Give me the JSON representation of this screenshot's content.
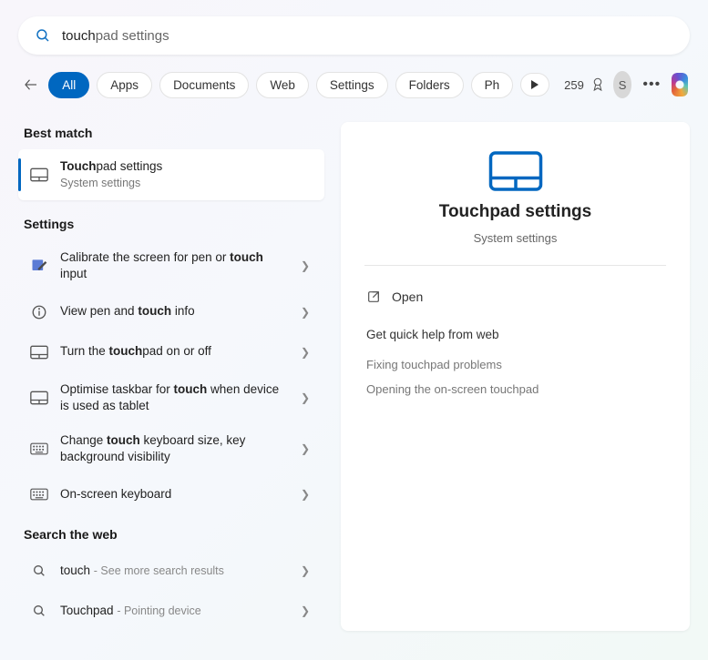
{
  "search": {
    "typed": "touch",
    "completion": "pad settings"
  },
  "filters": {
    "items": [
      "All",
      "Apps",
      "Documents",
      "Web",
      "Settings",
      "Folders",
      "Ph"
    ],
    "active_index": 0
  },
  "rewards": {
    "count": "259"
  },
  "avatar_initial": "S",
  "sections": {
    "best_match": {
      "label": "Best match",
      "item": {
        "title_prefix_bold": "Touch",
        "title_rest": "pad settings",
        "subtitle": "System settings"
      }
    },
    "settings": {
      "label": "Settings",
      "items": [
        {
          "icon": "pen-tablet",
          "segments": [
            "Calibrate the screen for pen or ",
            {
              "b": "touch"
            },
            " input"
          ]
        },
        {
          "icon": "info",
          "segments": [
            "View pen and ",
            {
              "b": "touch"
            },
            " info"
          ]
        },
        {
          "icon": "touchpad",
          "segments": [
            "Turn the ",
            {
              "b": "touch"
            },
            "pad on or off"
          ]
        },
        {
          "icon": "touchpad",
          "segments": [
            "Optimise taskbar for ",
            {
              "b": "touch"
            },
            " when device is used as tablet"
          ]
        },
        {
          "icon": "keyboard",
          "segments": [
            "Change ",
            {
              "b": "touch"
            },
            " keyboard size, key background visibility"
          ]
        },
        {
          "icon": "keyboard",
          "segments": [
            "On-screen keyboard"
          ]
        }
      ]
    },
    "web": {
      "label": "Search the web",
      "items": [
        {
          "term": "touch",
          "hint": "See more search results"
        },
        {
          "term": "Touchpad",
          "hint": "Pointing device"
        }
      ]
    }
  },
  "preview": {
    "title": "Touchpad settings",
    "subtitle": "System settings",
    "open_label": "Open",
    "help_title": "Get quick help from web",
    "help_links": [
      "Fixing touchpad problems",
      "Opening the on-screen touchpad"
    ]
  }
}
